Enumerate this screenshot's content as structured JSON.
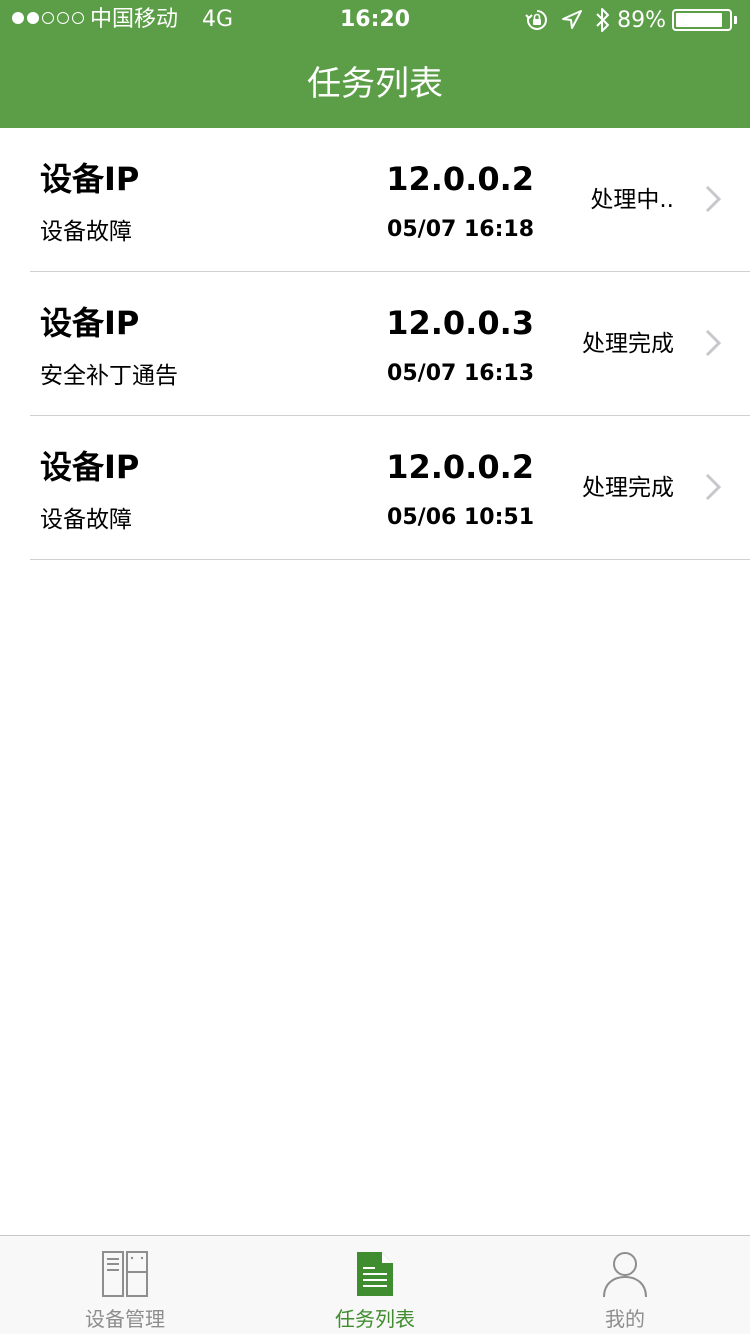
{
  "status_bar": {
    "carrier": "●●○○○ 中国移动",
    "network": "4G",
    "time": "16:20",
    "battery_percent": "89%",
    "battery_level": 0.89,
    "icons": [
      "rotation-lock-icon",
      "location-icon",
      "bluetooth-icon",
      "battery-icon"
    ]
  },
  "nav": {
    "title": "任务列表"
  },
  "tasks": [
    {
      "ip_label": "设备IP",
      "ip": "12.0.0.2",
      "type": "设备故障",
      "time": "05/07 16:18",
      "status": "处理中.."
    },
    {
      "ip_label": "设备IP",
      "ip": "12.0.0.3",
      "type": "安全补丁通告",
      "time": "05/07 16:13",
      "status": "处理完成"
    },
    {
      "ip_label": "设备IP",
      "ip": "12.0.0.2",
      "type": "设备故障",
      "time": "05/06 10:51",
      "status": "处理完成"
    }
  ],
  "tab_bar": {
    "tabs": [
      {
        "label": "设备管理",
        "icon": "device-management-icon",
        "active": false
      },
      {
        "label": "任务列表",
        "icon": "task-list-icon",
        "active": true
      },
      {
        "label": "我的",
        "icon": "profile-icon",
        "active": false
      }
    ]
  },
  "colors": {
    "brand_green": "#5b9e47",
    "active_tab": "#3f8d2e",
    "inactive_tab": "#8e8e8e"
  }
}
